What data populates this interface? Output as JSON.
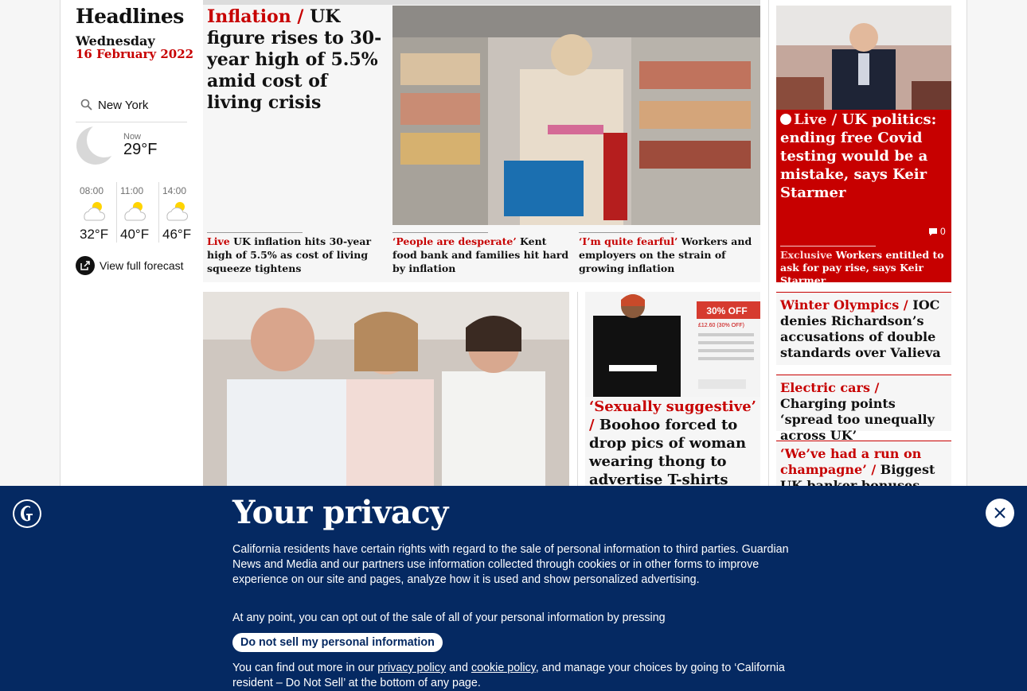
{
  "sidebar": {
    "title": "Headlines",
    "day": "Wednesday",
    "date": "16 February 2022",
    "weather": {
      "city": "New York",
      "now_label": "Now",
      "now_temp": "29°F",
      "forecast": [
        {
          "time": "08:00",
          "temp": "32°F"
        },
        {
          "time": "11:00",
          "temp": "40°F"
        },
        {
          "time": "14:00",
          "temp": "46°F"
        }
      ],
      "full_forecast_label": "View full forecast"
    }
  },
  "lead": {
    "kicker": "Inflation /",
    "headline": "UK figure rises to 30-year high of 5.5% amid cost of living crisis",
    "subs": [
      {
        "kicker": "Live",
        "text": "UK inflation hits 30-year high of 5.5% as cost of living squeeze tightens"
      },
      {
        "kicker": "‘People are desperate’",
        "text": "Kent food bank and families hit hard by inflation"
      },
      {
        "kicker": "‘I’m quite fearful’",
        "text": "Workers and employers on the strain of growing inflation"
      }
    ]
  },
  "live_story": {
    "kicker": "Live /",
    "headline": "UK politics: ending free Covid testing would be a mistake, says Keir Starmer",
    "comments": "0",
    "sub_kicker": "Exclusive",
    "sub_text": "Workers entitled to ask for pay rise, says Keir Starmer"
  },
  "right_stories": [
    {
      "kicker": "Winter Olympics  /",
      "text": "IOC denies Richardson’s accusations of double standards over Valieva"
    },
    {
      "kicker": "Electric cars /",
      "text": "Charging points ‘spread too unequally across UK’"
    },
    {
      "kicker": "‘We’ve had a run on champagne’ /",
      "text": "Biggest UK banker bonuses since"
    }
  ],
  "boohoo": {
    "kicker": "‘Sexually suggestive’ /",
    "headline": "Boohoo forced to drop pics of woman wearing thong to advertise T-shirts",
    "img_banner": "30% OFF",
    "img_price": "£12.60 (30% OFF)"
  },
  "privacy": {
    "title": "Your privacy",
    "para1": "California residents have certain rights with regard to the sale of personal information to third parties. Guardian News and Media and our partners use information collected through cookies or in other forms to improve experience on our site and pages, analyze how it is used and show personalized advertising.",
    "para2": "At any point, you can opt out of the sale of all of your personal information by pressing",
    "button": "Do not sell my personal information",
    "para3_a": "You can find out more in our",
    "privacy_link": "privacy policy",
    "and": "and",
    "cookie_link": "cookie policy",
    "para3_b": ", and manage your choices by going to ‘California resident – Do Not Sell’ at the bottom of any page."
  },
  "colors": {
    "brand_blue": "#052962",
    "news_red": "#c70000"
  }
}
